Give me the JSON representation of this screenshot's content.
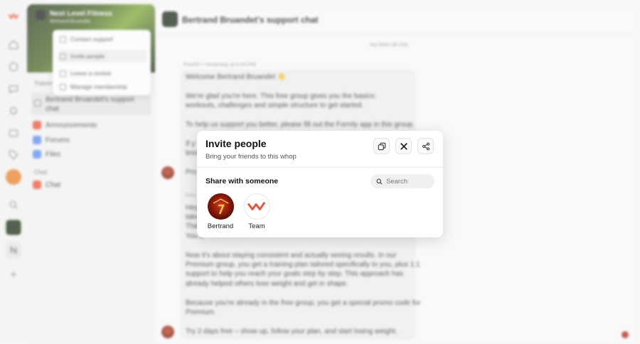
{
  "sidebar": {
    "group_title": "Next Level Fitness",
    "group_sub": "Bertrand Bruandet",
    "menu": [
      {
        "label": "Contact support",
        "icon": "support-icon"
      },
      {
        "label": "Invite people",
        "icon": "invite-icon"
      },
      {
        "label": "Leave a review",
        "icon": "star-icon"
      },
      {
        "label": "Manage membership",
        "icon": "settings-icon"
      }
    ],
    "section_label": "Trainin",
    "active_item": "Bertrand Bruandet's support chat",
    "items": [
      {
        "label": "Announcements",
        "color": "#e8543a"
      },
      {
        "label": "Forums",
        "color": "#5b8def"
      },
      {
        "label": "Files",
        "color": "#5b8def"
      }
    ],
    "chat_section": "Chat",
    "chat_item": "Chat"
  },
  "main": {
    "title": "Bertrand Bruandet's support chat",
    "divider": "Not listen all chat",
    "meta": "FreshF • Yesterday at 6:43 PM",
    "lines": [
      "Welcome Bertrand Bruandet 👋",
      "We're glad you're here. This free group gives you the basics:",
      "workouts, challenges and simple structure to get started.",
      "To help us support you better, please fill out the Formly app in this group.",
      "If y",
      "less",
      "Pro",
      "Fres",
      "Hey",
      "take",
      "That",
      "You s",
      "Now it's about staying consistent and actually seeing results. In our",
      "Premium group, you get a training plan tailored specifically to you, plus 1:1",
      "support to help you reach your goals step by step. This approach has",
      "already helped others lose weight and get in shape.",
      "Because you're already in the free group, you get a special promo code for",
      "Premium.",
      "Try 2 days free – show up, follow your plan, and start losing weight."
    ]
  },
  "modal": {
    "title": "Invite people",
    "subtitle": "Bring your friends to this whop",
    "share_title": "Share with someone",
    "search_placeholder": "Search",
    "actions": [
      {
        "name": "copy-link-button",
        "icon": "copy-icon"
      },
      {
        "name": "share-x-button",
        "icon": "x-logo-icon"
      },
      {
        "name": "share-button",
        "icon": "share-icon"
      }
    ],
    "people": [
      {
        "name": "Bertrand",
        "avatar": "bertrand-avatar"
      },
      {
        "name": "Team",
        "avatar": "whop-logo"
      }
    ]
  },
  "colors": {
    "brand_red": "#e8543a",
    "modal_bg": "#ffffff"
  }
}
